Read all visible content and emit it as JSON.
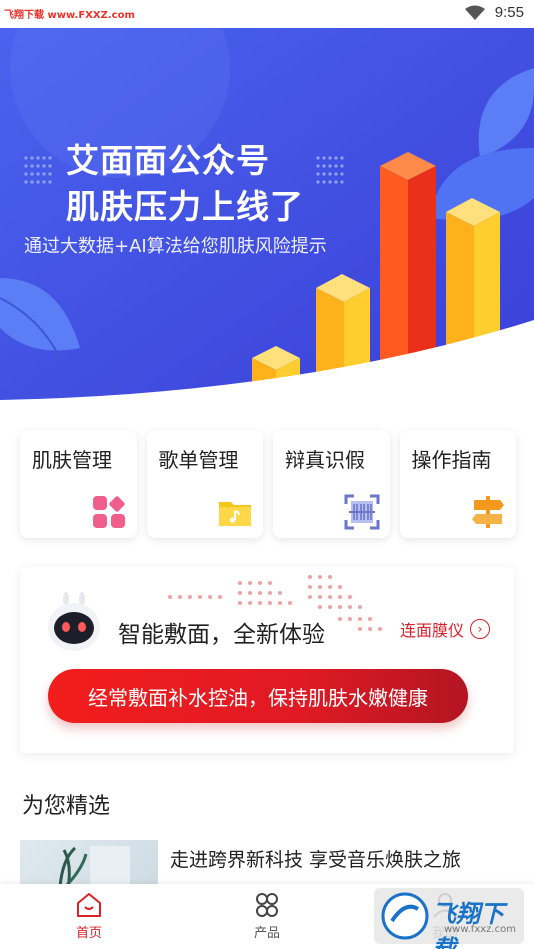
{
  "status_bar": {
    "watermark": "飞翔下载 www.FXXZ.com",
    "time": "9:55"
  },
  "banner": {
    "title_line1": "艾面面公众号",
    "title_line2": "肌肤压力上线了",
    "subtitle": "通过大数据+AI算法给您肌肤风险提示"
  },
  "features": [
    {
      "label": "肌肤管理",
      "icon": "grid-icon",
      "color": "#f05e8c"
    },
    {
      "label": "歌单管理",
      "icon": "music-folder-icon",
      "color": "#f5c518"
    },
    {
      "label": "辩真识假",
      "icon": "scan-icon",
      "color": "#6b76c9"
    },
    {
      "label": "操作指南",
      "icon": "signpost-icon",
      "color": "#f39a1e"
    }
  ],
  "mask_card": {
    "title": "智能敷面，全新体验",
    "link": "连面膜仪",
    "cta": "经常敷面补水控油，保持肌肤水嫩健康"
  },
  "section": {
    "title": "为您精选",
    "article_title": "走进跨界新科技 享受音乐焕肤之旅"
  },
  "bottom_nav": [
    {
      "label": "首页",
      "icon": "home-icon",
      "active": true
    },
    {
      "label": "产品",
      "icon": "products-icon",
      "active": false
    },
    {
      "label": "我的",
      "icon": "user-icon",
      "active": false
    }
  ],
  "watermark_bottom": {
    "text": "飞翔下载",
    "url": "www.fxxz.com"
  },
  "colors": {
    "brand_red": "#d9222a",
    "banner_blue": "#3a4fe0"
  }
}
